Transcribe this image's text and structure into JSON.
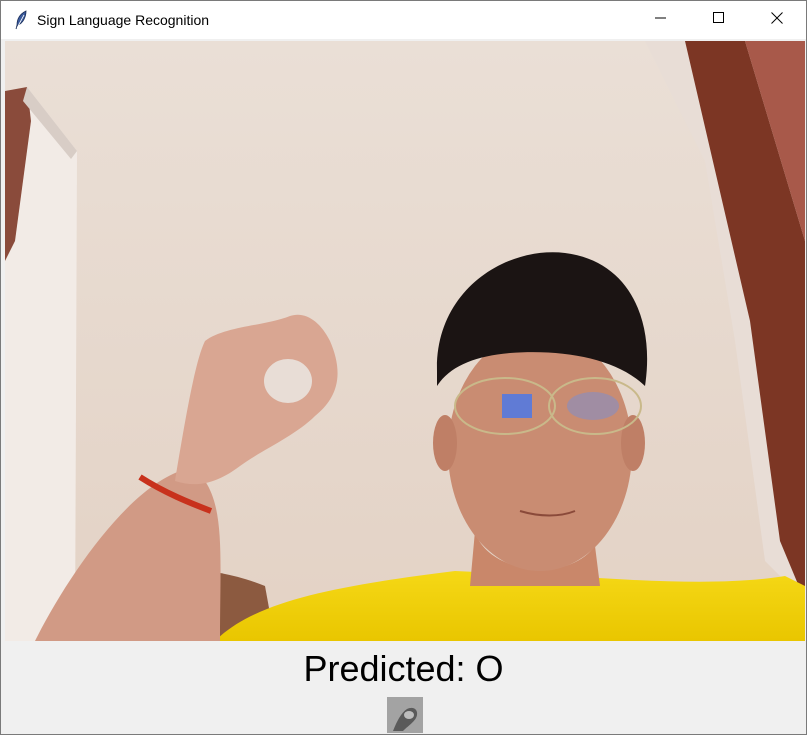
{
  "window": {
    "title": "Sign Language Recognition",
    "icon": "feather-icon",
    "controls": [
      "minimize-icon",
      "maximize-icon",
      "close-icon"
    ]
  },
  "prediction": {
    "text": "Predicted: O"
  },
  "camera": {
    "description_icon": "webcam-feed"
  },
  "colors": {
    "titlebar": "#ffffff",
    "window_bg": "#f0f0f0",
    "wall": "#e9ddd3",
    "shirt": "#f2d20a",
    "text": "#000000"
  }
}
